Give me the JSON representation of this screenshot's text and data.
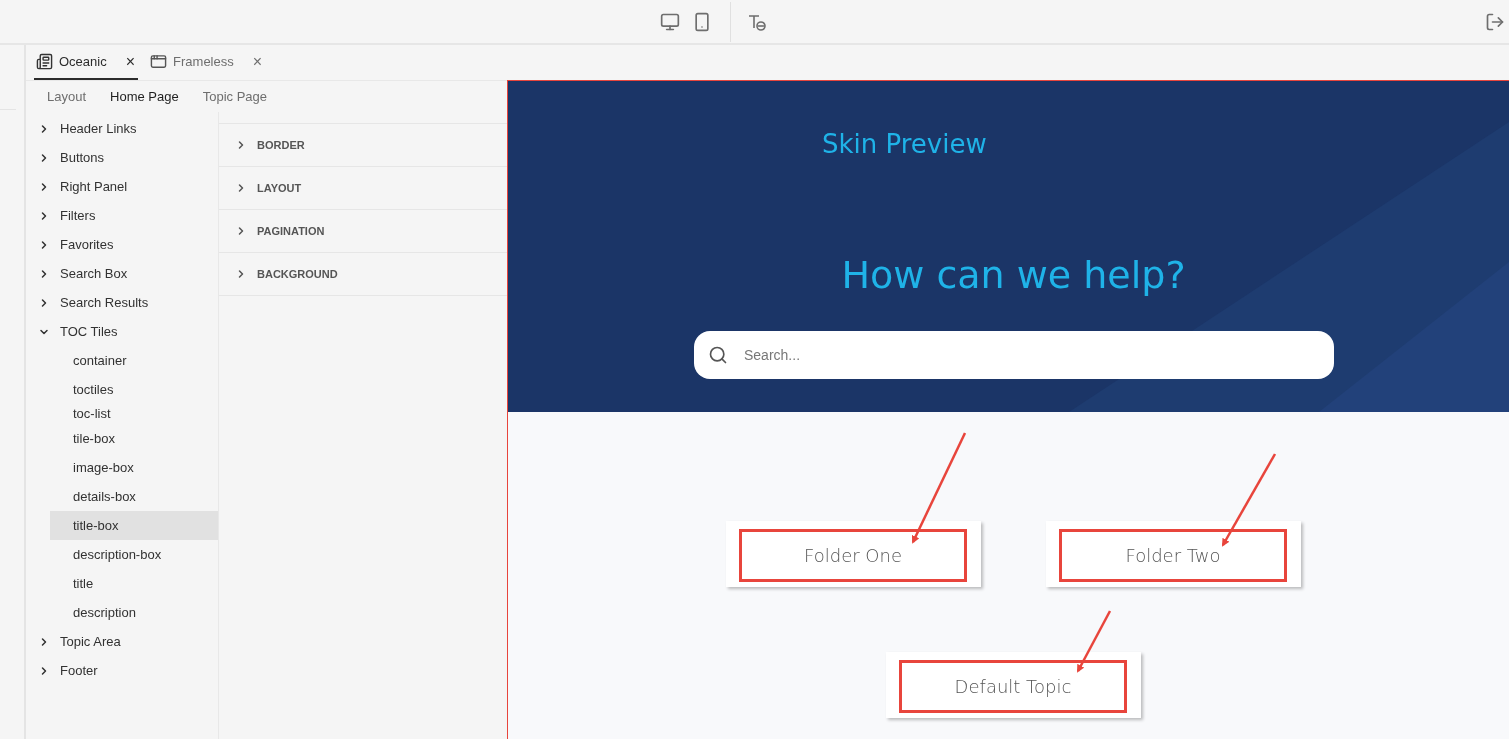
{
  "toolbar": {
    "icons": [
      {
        "kind": "desktop",
        "selected": false
      },
      {
        "kind": "mobile",
        "selected": false
      },
      {
        "kind": "divider"
      },
      {
        "kind": "text-style",
        "selected": false
      },
      {
        "kind": "spacer"
      },
      {
        "kind": "exit",
        "selected": false
      }
    ]
  },
  "skin_tabs": [
    {
      "label": "Oceanic",
      "kind": "layout",
      "selected": true,
      "close": "×"
    },
    {
      "label": "Frameless",
      "kind": "window",
      "selected": false,
      "close": "×"
    }
  ],
  "page_tabs": [
    {
      "label": "Layout",
      "selected": false
    },
    {
      "label": "Home Page",
      "selected": true
    },
    {
      "label": "Topic Page",
      "selected": false
    }
  ],
  "tree": [
    {
      "label": "Header Links",
      "expanded": false
    },
    {
      "label": "Buttons",
      "expanded": false
    },
    {
      "label": "Right Panel",
      "expanded": false
    },
    {
      "label": "Filters",
      "expanded": false
    },
    {
      "label": "Favorites",
      "expanded": false
    },
    {
      "label": "Search Box",
      "expanded": false
    },
    {
      "label": "Search Results",
      "expanded": false
    },
    {
      "label": "TOC Tiles",
      "expanded": true,
      "children": [
        {
          "label": "container",
          "selected": false
        },
        {
          "label": "toctiles",
          "selected": false
        },
        {
          "label": "toc-list",
          "selected": false
        },
        {
          "label": "tile-box",
          "selected": false
        },
        {
          "label": "image-box",
          "selected": false
        },
        {
          "label": "details-box",
          "selected": false
        },
        {
          "label": "title-box",
          "selected": true
        },
        {
          "label": "description-box",
          "selected": false
        },
        {
          "label": "title",
          "selected": false
        },
        {
          "label": "description",
          "selected": false
        }
      ]
    },
    {
      "label": "Topic Area",
      "expanded": false
    },
    {
      "label": "Footer",
      "expanded": false
    }
  ],
  "sections": [
    {
      "label": "BORDER",
      "expanded": false
    },
    {
      "label": "LAYOUT",
      "expanded": false
    },
    {
      "label": "PAGINATION",
      "expanded": false
    },
    {
      "label": "BACKGROUND",
      "expanded": false
    }
  ],
  "preview": {
    "title": "Skin Preview",
    "heading": "How can we help?",
    "search": {
      "placeholder": "Search..."
    },
    "tile_rows": [
      [
        {
          "title": "Folder One",
          "highlighted": true
        },
        {
          "title": "Folder Two",
          "highlighted": true
        }
      ],
      [
        {
          "title": "Default Topic",
          "highlighted": true
        }
      ]
    ]
  }
}
